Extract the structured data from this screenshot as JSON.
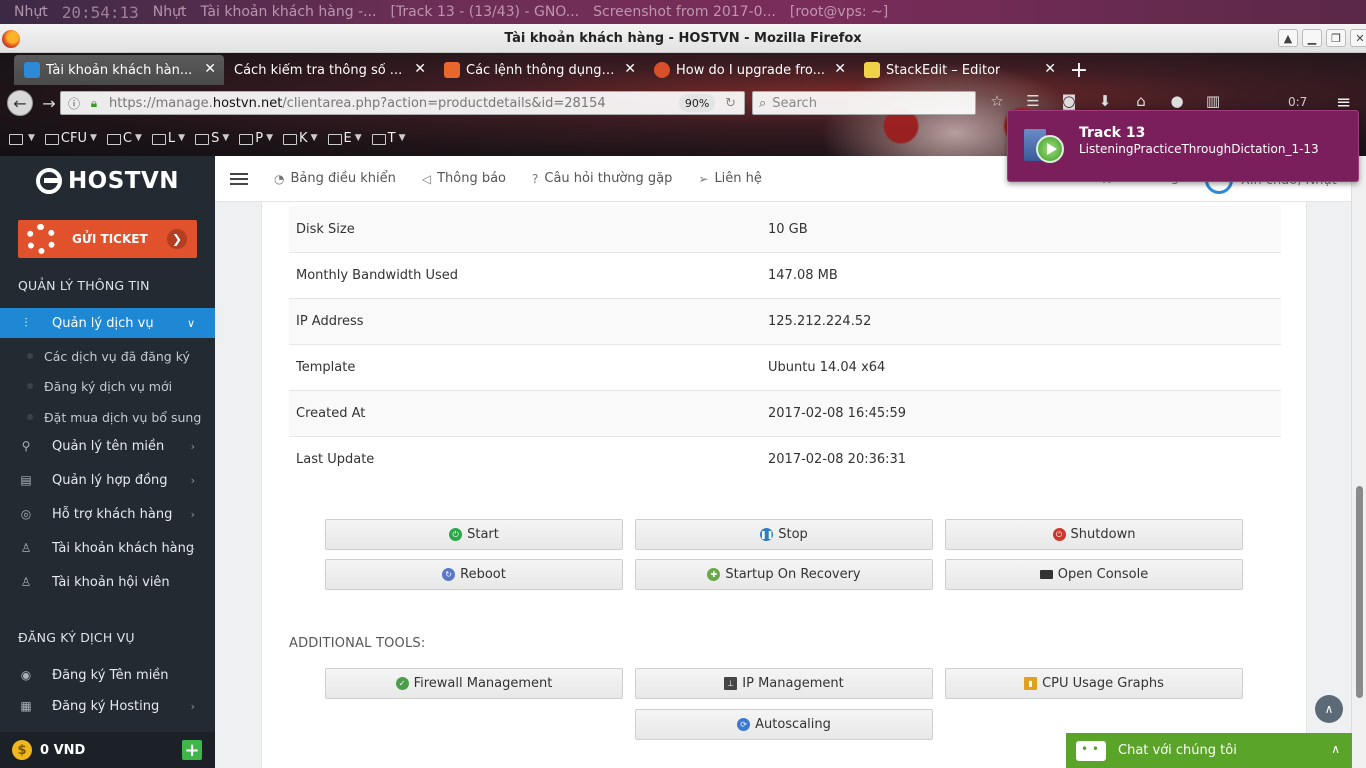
{
  "desktop": {
    "items": [
      "Nhựt",
      "20:54:13",
      "Nhựt",
      "Tài khoản khách hàng -...",
      "[Track 13 - (13/43) - GNO...",
      "Screenshot from 2017-0...",
      "[root@vps: ~]"
    ]
  },
  "window": {
    "title": "Tài khoản khách hàng - HOSTVN - Mozilla Firefox"
  },
  "tabs": [
    {
      "title": "Tài khoản khách hàn...",
      "color": "#2e8ad6"
    },
    {
      "title": "Cách kiểm tra thông số ...",
      "color": ""
    },
    {
      "title": "Các lệnh thông dụng ...",
      "color": "#e8672a"
    },
    {
      "title": "How do I upgrade fro...",
      "color": "#d8502a"
    },
    {
      "title": "StackEdit – Editor",
      "color": "#f0d24a"
    }
  ],
  "navbar": {
    "url_prefix": "https://manage.",
    "url_domain": "hostvn.net",
    "url_path": "/clientarea.php?action=productdetails&id=28154",
    "zoom": "90%",
    "search_placeholder": "Search",
    "counter": "0:7"
  },
  "bookmarks": [
    "CFU",
    "C",
    "L",
    "S",
    "P",
    "K",
    "E",
    "T"
  ],
  "notification": {
    "title": "Track 13",
    "body": "ListeningPracticeThroughDictation_1-13"
  },
  "sidebar": {
    "brand": "HOSTVN",
    "ticket_label": "GỬI TICKET",
    "section_manage": "QUẢN LÝ THÔNG TIN",
    "items": [
      {
        "label": "Quản lý dịch vụ",
        "icon": "sliders-icon"
      },
      {
        "label": "Quản lý tên miền",
        "icon": "network-icon"
      },
      {
        "label": "Quản lý hợp đồng",
        "icon": "contract-icon"
      },
      {
        "label": "Hỗ trợ khách hàng",
        "icon": "support-icon"
      },
      {
        "label": "Tài khoản khách hàng",
        "icon": "user-icon"
      },
      {
        "label": "Tài khoản hội viên",
        "icon": "member-icon"
      }
    ],
    "subitems": [
      "Các dịch vụ đã đăng ký",
      "Đăng ký dịch vụ mới",
      "Đặt mua dịch vụ bổ sung"
    ],
    "section_register": "ĐĂNG KÝ DỊCH VỤ",
    "register_items": [
      {
        "label": "Đăng ký Tên miền",
        "icon": "globe-icon"
      },
      {
        "label": "Đăng ký Hosting",
        "icon": "server-icon"
      }
    ],
    "balance": "0 VND"
  },
  "topnav": {
    "items": [
      {
        "label": "Bảng điều khiển",
        "icon": "dashboard-icon"
      },
      {
        "label": "Thông báo",
        "icon": "megaphone-icon"
      },
      {
        "label": "Câu hỏi thường gặp",
        "icon": "question-icon"
      },
      {
        "label": "Liên hệ",
        "icon": "send-icon"
      }
    ],
    "cart": "Giỏ hàng",
    "greeting": "Xin chào, Nhựt"
  },
  "details": [
    {
      "key": "Disk Size",
      "value": "10 GB"
    },
    {
      "key": "Monthly Bandwidth Used",
      "value": "147.08 MB"
    },
    {
      "key": "IP Address",
      "value": "125.212.224.52"
    },
    {
      "key": "Template",
      "value": "Ubuntu 14.04 x64"
    },
    {
      "key": "Created At",
      "value": "2017-02-08 16:45:59"
    },
    {
      "key": "Last Update",
      "value": "2017-02-08 20:36:31"
    }
  ],
  "actions": [
    {
      "label": "Start",
      "icon": "power-on-icon",
      "color": "#2aa84a"
    },
    {
      "label": "Stop",
      "icon": "pause-icon",
      "color": "#2b7fc0"
    },
    {
      "label": "Shutdown",
      "icon": "power-off-icon",
      "color": "#d0362a"
    },
    {
      "label": "Reboot",
      "icon": "refresh-icon",
      "color": "#5a78c8"
    },
    {
      "label": "Startup On Recovery",
      "icon": "recovery-icon",
      "color": "#6aa84a"
    },
    {
      "label": "Open Console",
      "icon": "terminal-icon",
      "color": "#333333"
    }
  ],
  "additional_tools_label": "ADDITIONAL TOOLS:",
  "tools": [
    {
      "label": "Firewall Management",
      "icon": "shield-icon",
      "color": "#4aa04a"
    },
    {
      "label": "IP Management",
      "icon": "sitemap-icon",
      "color": "#444444"
    },
    {
      "label": "CPU Usage Graphs",
      "icon": "chart-icon",
      "color": "#e0a020"
    },
    {
      "label": "Autoscaling",
      "icon": "autoscale-icon",
      "color": "#3a7ad0"
    }
  ],
  "chat": {
    "label": "Chat với chúng tôi"
  }
}
